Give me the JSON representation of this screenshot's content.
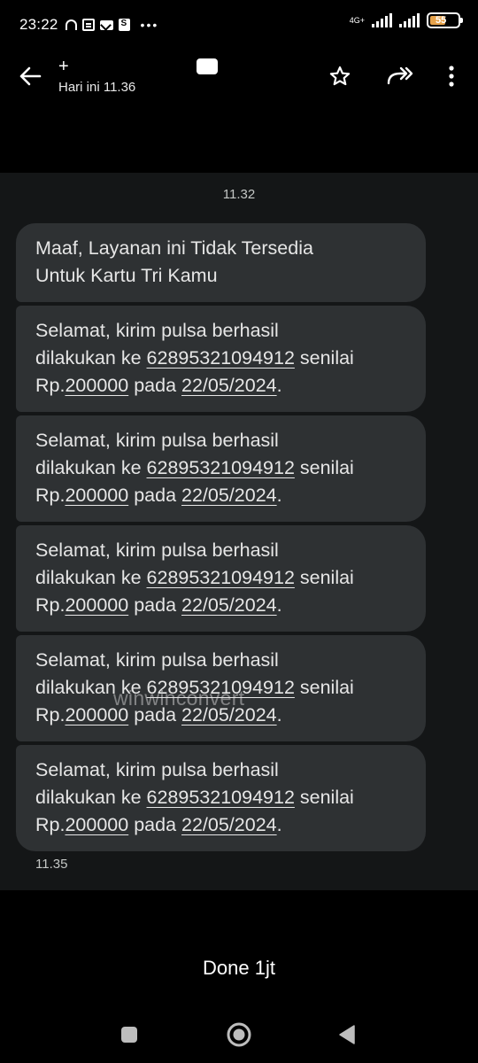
{
  "status_bar": {
    "time": "23:22",
    "network_type": "4G+",
    "battery_level": "55",
    "battery_percent": 55,
    "more_glyph": "•••",
    "icons": [
      "headset-icon",
      "news-icon",
      "mail-icon",
      "shop-icon",
      "signal-icon",
      "battery-icon"
    ]
  },
  "header": {
    "contact_name": "+",
    "subtitle": "Hari ini 11.36",
    "icons": [
      "back-arrow-icon",
      "star-icon",
      "forward-icon",
      "more-vert-icon"
    ]
  },
  "conversation": {
    "time_separator": "11.32",
    "messages": [
      {
        "lines": [
          "Maaf, Layanan ini Tidak Tersedia",
          "Untuk Kartu Tri Kamu"
        ]
      },
      {
        "line1": "Selamat, kirim pulsa berhasil",
        "line2_prefix": "dilakukan ke ",
        "phone": "62895321094912",
        "line2_suffix": " senilai",
        "line3_prefix": "Rp.",
        "amount": "200000",
        "line3_mid": " pada ",
        "date": "22/05/2024",
        "line3_suffix": "."
      },
      {
        "line1": "Selamat, kirim pulsa berhasil",
        "line2_prefix": "dilakukan ke ",
        "phone": "62895321094912",
        "line2_suffix": " senilai",
        "line3_prefix": "Rp.",
        "amount": "200000",
        "line3_mid": " pada ",
        "date": "22/05/2024",
        "line3_suffix": "."
      },
      {
        "line1": "Selamat, kirim pulsa berhasil",
        "line2_prefix": "dilakukan ke ",
        "phone": "62895321094912",
        "line2_suffix": " senilai",
        "line3_prefix": "Rp.",
        "amount": "200000",
        "line3_mid": " pada ",
        "date": "22/05/2024",
        "line3_suffix": "."
      },
      {
        "line1": "Selamat, kirim pulsa berhasil",
        "line2_prefix": "dilakukan ke ",
        "phone": "62895321094912",
        "line2_suffix": " senilai",
        "line3_prefix": "Rp.",
        "amount": "200000",
        "line3_mid": " pada ",
        "date": "22/05/2024",
        "line3_suffix": "."
      },
      {
        "line1": "Selamat, kirim pulsa berhasil",
        "line2_prefix": "dilakukan ke ",
        "phone": "62895321094912",
        "line2_suffix": " senilai",
        "line3_prefix": "Rp.",
        "amount": "200000",
        "line3_mid": " pada ",
        "date": "22/05/2024",
        "line3_suffix": "."
      }
    ],
    "sent_time": "11.35",
    "watermark": "winwinconvert"
  },
  "caption": "Done 1jt",
  "nav_bar": {
    "icons": [
      "recents-square-icon",
      "home-circle-icon",
      "back-triangle-icon"
    ]
  },
  "colors": {
    "background": "#000000",
    "conversation_bg": "#141617",
    "bubble_bg": "#2e3133",
    "bubble_text": "#e6e6e6",
    "battery_fill": "#e6a24b"
  }
}
